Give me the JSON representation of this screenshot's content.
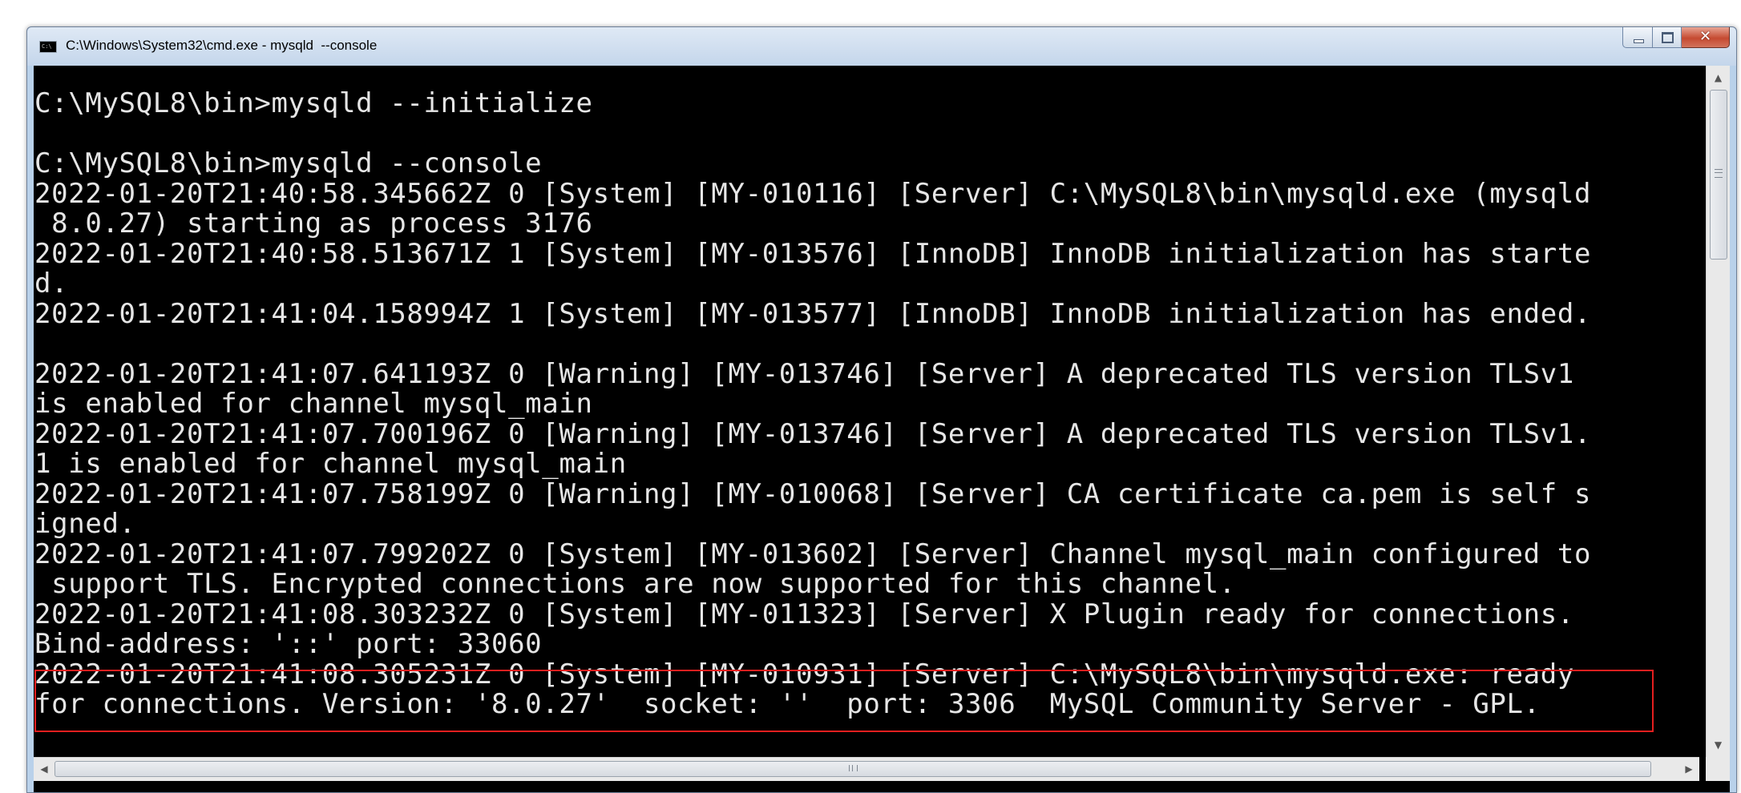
{
  "window": {
    "title": "C:\\Windows\\System32\\cmd.exe - mysqld  --console",
    "icon": "cmd-icon",
    "icon_text": "C:\\",
    "buttons": {
      "minimize": "minimize-icon",
      "maximize": "maximize-icon",
      "close": "close-icon",
      "close_glyph": "✕"
    }
  },
  "console": {
    "text_color": "#e6e6e6",
    "background": "#000000",
    "lines": [
      "C:\\MySQL8\\bin>mysqld --initialize",
      "",
      "C:\\MySQL8\\bin>mysqld --console",
      "2022-01-20T21:40:58.345662Z 0 [System] [MY-010116] [Server] C:\\MySQL8\\bin\\mysqld.exe (mysqld",
      " 8.0.27) starting as process 3176",
      "2022-01-20T21:40:58.513671Z 1 [System] [MY-013576] [InnoDB] InnoDB initialization has starte",
      "d.",
      "2022-01-20T21:41:04.158994Z 1 [System] [MY-013577] [InnoDB] InnoDB initialization has ended.",
      "",
      "2022-01-20T21:41:07.641193Z 0 [Warning] [MY-013746] [Server] A deprecated TLS version TLSv1",
      "is enabled for channel mysql_main",
      "2022-01-20T21:41:07.700196Z 0 [Warning] [MY-013746] [Server] A deprecated TLS version TLSv1.",
      "1 is enabled for channel mysql_main",
      "2022-01-20T21:41:07.758199Z 0 [Warning] [MY-010068] [Server] CA certificate ca.pem is self s",
      "igned.",
      "2022-01-20T21:41:07.799202Z 0 [System] [MY-013602] [Server] Channel mysql_main configured to",
      " support TLS. Encrypted connections are now supported for this channel.",
      "2022-01-20T21:41:08.303232Z 0 [System] [MY-011323] [Server] X Plugin ready for connections.",
      "Bind-address: '::' port: 33060",
      "2022-01-20T21:41:08.305231Z 0 [System] [MY-010931] [Server] C:\\MySQL8\\bin\\mysqld.exe: ready",
      "for connections. Version: '8.0.27'  socket: ''  port: 3306  MySQL Community Server - GPL."
    ],
    "highlight_color": "#e41f1f"
  },
  "scrollbars": {
    "up_arrow": "▲",
    "down_arrow": "▼",
    "left_arrow": "◀",
    "right_arrow": "▶"
  }
}
